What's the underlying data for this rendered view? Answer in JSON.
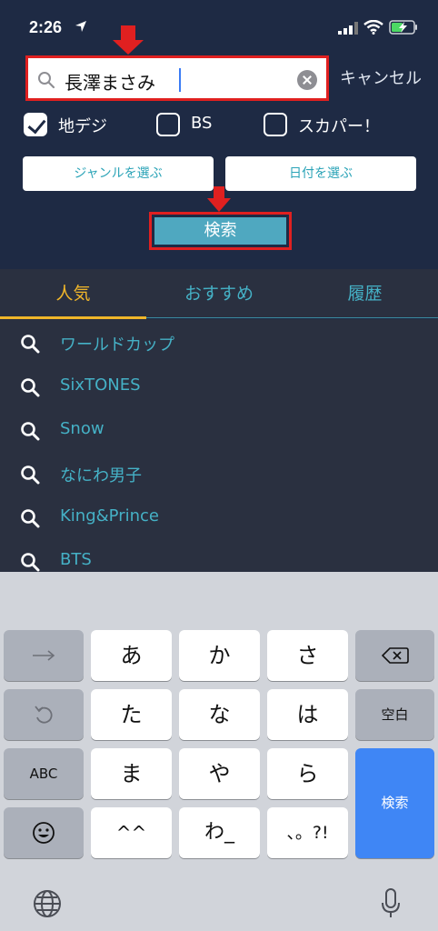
{
  "status": {
    "time": "2:26"
  },
  "search": {
    "query": "長澤まさみ",
    "cancel_label": "キャンセル"
  },
  "filters": [
    {
      "label": "地デジ",
      "checked": true
    },
    {
      "label": "BS",
      "checked": false
    },
    {
      "label": "スカパー！",
      "checked": false
    }
  ],
  "buttons": {
    "genre": "ジャンルを選ぶ",
    "date": "日付を選ぶ",
    "search": "検索"
  },
  "tabs": [
    {
      "label": "人気",
      "active": true
    },
    {
      "label": "おすすめ",
      "active": false
    },
    {
      "label": "履歴",
      "active": false
    }
  ],
  "suggestions": [
    "ワールドカップ",
    "SixTONES",
    "Snow",
    "なにわ男子",
    "King&Prince",
    "BTS"
  ],
  "keyboard": {
    "row1": [
      "あ",
      "か",
      "さ"
    ],
    "row2": [
      "た",
      "な",
      "は"
    ],
    "row3": [
      "ま",
      "や",
      "ら"
    ],
    "row4": [
      "^^",
      "わ_",
      "、。?!"
    ],
    "abc": "ABC",
    "space": "空白",
    "enter": "検索"
  },
  "colors": {
    "accent": "#f0b62a",
    "link": "#45b1c6",
    "highlight": "#e02020",
    "enter": "#3f86f5"
  }
}
